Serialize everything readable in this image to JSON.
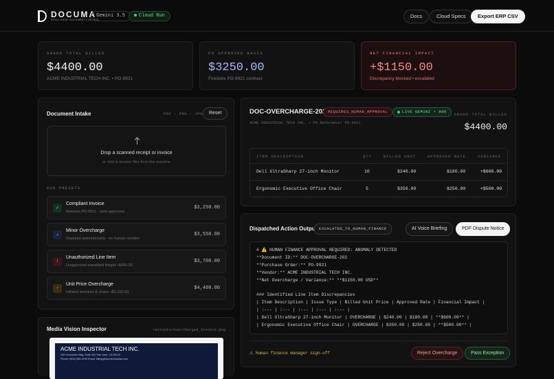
{
  "brand": {
    "name": "DOCUMA",
    "tagline": "INTELLIGENT DOCUMENT CONTROL"
  },
  "header": {
    "model_pill": "Gemini 3.5",
    "cloud_pill": "Cloud Run",
    "docs_label": "Docs",
    "specs_label": "Cloud Specs",
    "export_label": "Export ERP CSV"
  },
  "kpis": [
    {
      "label": "GRAND TOTAL BILLED",
      "value": "$4400.00",
      "sub": "ACME INDUSTRIAL TECH INC. • PO-9921"
    },
    {
      "label": "PO APPROVED BASIS",
      "value": "$3250.00",
      "sub": "Firestore PO-9921 contract"
    },
    {
      "label": "NET FINANCIAL IMPACT",
      "value": "+$1150.00",
      "sub": "Discrepancy blocked • escalated"
    }
  ],
  "intake": {
    "title": "Document Intake",
    "formats": "PDF · PNG · JPG",
    "reset_label": "Reset",
    "drop_title": "Drop a scanned receipt or invoice",
    "drop_sub": "or click to browse files from this machine",
    "presets_label": "RUN PRESETS",
    "presets": [
      {
        "icon": "✓",
        "title": "Compliant Invoice",
        "sub": "Matches PO-9921 · auto-approved",
        "price": "$3,250.00"
      },
      {
        "icon": "♪",
        "title": "Minor Overcharge",
        "sub": "Disputed autonomously · no human needed",
        "price": "$3,550.00"
      },
      {
        "icon": "!",
        "title": "Unauthorized Line Item",
        "sub": "Unapproved expedited freight +$450.00",
        "price": "$3,700.00"
      },
      {
        "icon": "↑",
        "title": "Unit Price Overcharge",
        "sub": "Inflated monitors & chairs +$1,150.00",
        "price": "$4,400.00"
      }
    ]
  },
  "vision": {
    "title": "Media Vision Inspector",
    "file": "receipts/overcharged_invoice.png",
    "invoice_company": "ACME INDUSTRIAL TECH INC.",
    "invoice_addr": "100 Innovation Way, Suite 400 San Jose, CA 95124",
    "invoice_contact": "Phone: (800) 555-0199 Email: billing@acmeindustrial.com"
  },
  "doc": {
    "id": "DOC-OVERCHARGE-202",
    "status_tag": "REQUIRES_HUMAN_APPROVAL",
    "live_tag": "LIVE GEMINI • 98%",
    "meta": "ACME INDUSTRIAL TECH INC. • PO Reference: PO-9921",
    "total_label": "GRAND TOTAL BILLED",
    "total_value": "$4400.00",
    "columns": [
      "ITEM DESCRIPTION",
      "QTY",
      "BILLED UNIT",
      "APPROVED RATE",
      "VARIANCE"
    ],
    "rows": [
      [
        "Dell UltraSharp 27-inch Monitor",
        "10",
        "$240.00",
        "$180.00",
        "+$600.00"
      ],
      [
        "Ergonomic Executive Office Chair",
        "5",
        "$350.00",
        "$250.00",
        "+$500.00"
      ]
    ]
  },
  "action": {
    "title": "Dispatched Action Output",
    "tag": "ESCALATED_TO_HUMAN_FINANCE",
    "voice_label": "AI Voice Briefing",
    "pdf_label": "PDF Dispute Notice",
    "lines": [
      "# ⚠️ HUMAN FINANCE APPROVAL REQUIRED: ANOMALY DETECTED",
      "**Document ID:** DOC-OVERCHARGE-202",
      "**Purchase Order:** PO-9921",
      "**Vendor:** ACME INDUSTRIAL TECH INC.",
      "**Net Overcharge / Variance:** **$1150.00 USD**",
      "",
      "### Identified Line Item Discrepancies",
      "| Item Description | Issue Type | Billed Unit Price | Approved Rate | Financial Impact |",
      "| :--- | :--- | :--- | :--- | :--- |",
      "| Dell UltraSharp 27-inch Monitor | OVERCHARGE | $240.00 | $180.00 | **$600.00** |",
      "| Ergonomic Executive Office Chair | OVERCHARGE | $350.00 | $250.00 | **$500.00** |"
    ],
    "signoff": "⚠ Human finance manager sign-off",
    "reject_label": "Reject Overcharge",
    "pass_label": "Pass Exception"
  }
}
